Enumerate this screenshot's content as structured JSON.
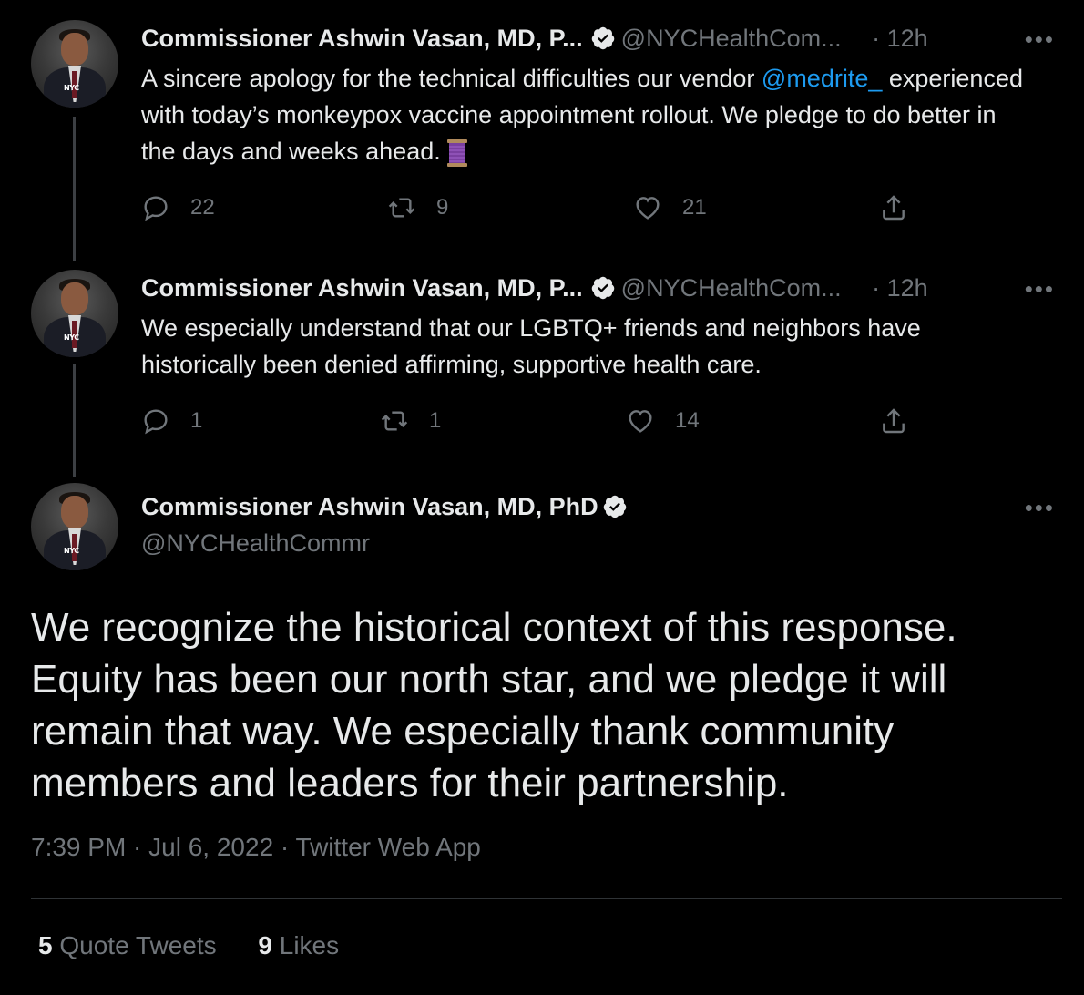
{
  "thread": [
    {
      "name": "Commissioner Ashwin Vasan, MD, P...",
      "handle": "@NYCHealthCom...",
      "time": "· 12h",
      "text_before_mention": "A sincere apology for the technical difficulties our vendor ",
      "mention": "@medrite_",
      "text_after_mention": " experienced with today’s monkeypox vaccine appointment rollout. We pledge to do better in the days and weeks ahead.",
      "emoji_icon": "thread-spool-icon",
      "replies": "22",
      "retweets": "9",
      "likes": "21"
    },
    {
      "name": "Commissioner Ashwin Vasan, MD, P...",
      "handle": "@NYCHealthCom...",
      "time": "· 12h",
      "text": "We especially understand that our LGBTQ+ friends and neighbors have historically been denied affirming, supportive health care.",
      "replies": "1",
      "retweets": "1",
      "likes": "14"
    }
  ],
  "main_tweet": {
    "name": "Commissioner Ashwin Vasan, MD, PhD",
    "handle": "@NYCHealthCommr",
    "text": "We recognize the historical context of this response. Equity has been our north star, and we pledge it will remain that way. We especially thank community members and leaders for their partnership.",
    "timestamp": "7:39 PM · Jul 6, 2022 · Twitter Web App",
    "quote_tweets_count": "5",
    "quote_tweets_label": "Quote Tweets",
    "likes_count": "9",
    "likes_label": "Likes"
  },
  "avatar_badge": "NYC",
  "more_label": "•••",
  "colors": {
    "background": "#000000",
    "text": "#e7e9ea",
    "secondary": "#71767b",
    "link": "#1d9bf0",
    "divider": "#2f3336",
    "verified_badge": "#e7e9ea"
  }
}
